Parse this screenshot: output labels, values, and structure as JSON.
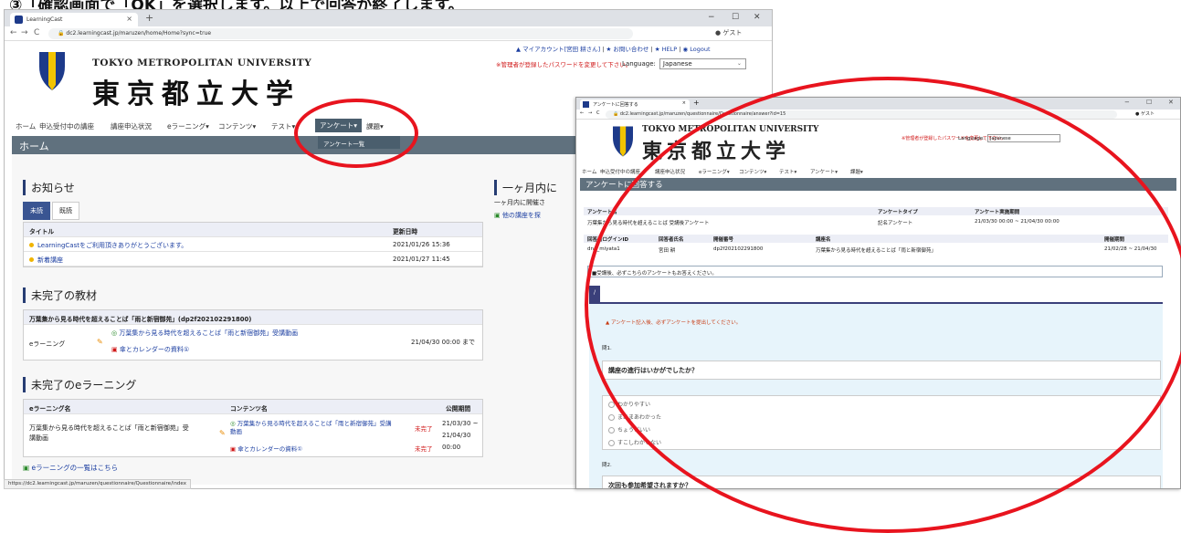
{
  "caption": "③「確認画面で「OK」を選択します。以上で回答が終了します。",
  "win1": {
    "tab_title": "LearningCast",
    "tab_close": "×",
    "new_tab": "+",
    "controls": {
      "minimize": "−",
      "maximize": "☐",
      "close": "✕"
    },
    "nav": {
      "back": "←",
      "forward": "→",
      "reload": "C"
    },
    "url": "dc2.learningcast.jp/maruzen/home/Home?sync=true",
    "profile": "ゲスト",
    "top_links": {
      "account": "▲ マイアカウント[宮田 耕さん]",
      "sep1": " | ",
      "contact": "★ お問い合わせ",
      "sep2": " | ",
      "help": "★ HELP",
      "sep3": " | ",
      "logout": "◉ Logout"
    },
    "pw_message": "※管理者が登録したパスワードを変更して下さい。",
    "language_label": "Language:",
    "language_value": "Japanese",
    "logo_en": "TOKYO METROPOLITAN UNIVERSITY",
    "logo_jp": "東京都立大学",
    "menu": [
      "ホーム",
      "申込受付中の講座",
      "講座申込状況",
      "eラーニング▾",
      "コンテンツ▾",
      "テスト▾",
      "アンケート▾",
      "課題▾"
    ],
    "dropdown_item": "アンケート一覧",
    "banner": "ホーム",
    "notice": {
      "heading": "お知らせ",
      "tabs": [
        "未読",
        "既読"
      ],
      "col_title": "タイトル",
      "col_date": "更新日時",
      "rows": [
        {
          "title": "LearningCastをご利用頂きありがとうございます。",
          "date": "2021/01/26 15:36"
        },
        {
          "title": "新着講座",
          "date": "2021/01/27 11:45"
        }
      ]
    },
    "materials": {
      "heading": "未完了の教材",
      "course": "万葉集から見る時代を超えることば「雨と新宿御苑」(dp2f202102291800)",
      "type": "eラーニング",
      "item1": "万葉集から見る時代を超えることば「雨と新宿御苑」受講動画",
      "item2": "傘とカレンダーの資料①",
      "deadline": "21/04/30 00:00 まで"
    },
    "elearning": {
      "heading": "未完了のeラーニング",
      "col1": "eラーニング名",
      "col2": "コンテンツ名",
      "col3": "公開期間",
      "name": "万葉集から見る時代を超えることば「雨と新宿御苑」受講動画",
      "content1": "万葉集から見る時代を超えることば「雨と新宿御苑」受講動画",
      "content2": "傘とカレンダーの資料①",
      "status1": "未完了",
      "status2": "未完了",
      "period1": "21/03/30 ~",
      "period2": "21/04/30",
      "period3": "00:00",
      "list_link": "eラーニングの一覧はこちら"
    },
    "side": {
      "heading": "一ヶ月内に",
      "text": "一ヶ月内に開催さ",
      "link": "他の講座を探"
    },
    "status_url": "https://dc2.learningcast.jp/maruzen/questionnaire/Questionnaire/index"
  },
  "win2": {
    "tab_title": "アンケートに回答する",
    "tab_close": "×",
    "new_tab": "+",
    "url": "dc2.learningcast.jp/maruzen/questionnaire/Questionnaire/answer?id=15",
    "profile": "ゲスト",
    "controls": {
      "minimize": "−",
      "maximize": "☐",
      "close": "✕"
    },
    "nav": {
      "back": "←",
      "forward": "→",
      "reload": "C"
    },
    "logo_en": "TOKYO METROPOLITAN UNIVERSITY",
    "logo_jp": "東京都立大学",
    "pw_message": "※管理者が登録したパスワードを変更して下さい。",
    "language_label": "Language:",
    "language_value": "Japanese",
    "menu": [
      "ホーム",
      "申込受付中の講座",
      "講座申込状況",
      "eラーニング▾",
      "コンテンツ▾",
      "テスト▾",
      "アンケート▾",
      "課題▾"
    ],
    "banner": "アンケートに回答する",
    "survey": {
      "h_name": "アンケート名",
      "h_type": "アンケートタイプ",
      "h_period": "アンケート実施期間",
      "name": "万葉集から見る時代を超えることば 受講後アンケート",
      "type": "記名アンケート",
      "period": "21/03/30 00:00 ~ 21/04/30 00:00",
      "h_login": "回答者ログインID",
      "h_answerer": "回答者氏名",
      "h_num": "開催番号",
      "h_course": "講座名",
      "h_dates": "開催期間",
      "login": "dnp_miyata1",
      "answerer": "宮田 耕",
      "num": "dp2f202102291800",
      "course": "万葉集から見る時代を超えることば「雨と新宿御苑」",
      "dates": "21/02/28 ~ 21/04/30"
    },
    "note": "■受講後、必ずこちらのアンケートもお答えください。",
    "q_tab": "/",
    "warning": "▲ アンケート記入後、必ずアンケートを提出してください。",
    "q1_num": "問1.",
    "q1_text": "講座の進行はいかがでしたか？",
    "q1_options": [
      "わかりやすい",
      "まあまあわかった",
      "ちょうどいい",
      "すこしわからない"
    ],
    "q2_num": "問2.",
    "q2_text": "次回も参加希望されますか？"
  },
  "colors": {
    "accent": "#3a5592",
    "banner": "#60717e",
    "highlight": "#e8141e",
    "warning": "#d01818"
  }
}
